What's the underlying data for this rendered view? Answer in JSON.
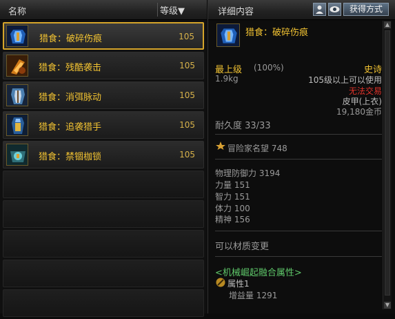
{
  "list": {
    "header_name": "名称",
    "header_level": "等级▼",
    "items": [
      {
        "label": "猎食：破碎伤痕",
        "level": "105"
      },
      {
        "label": "猎食：残酷袭击",
        "level": "105"
      },
      {
        "label": "猎食：消弭脉动",
        "level": "105"
      },
      {
        "label": "猎食：追袭猎手",
        "level": "105"
      },
      {
        "label": "猎食：禁锢枷锁",
        "level": "105"
      }
    ]
  },
  "detail": {
    "title": "详细内容",
    "obtain_button": "获得方式",
    "name": "猎食：破碎伤痕",
    "grade": "最上级",
    "grade_pct": "(100%)",
    "rarity": "史诗",
    "weight": "1.9kg",
    "level_req": "105级以上可以使用",
    "trade": "无法交易",
    "slot": "皮甲(上衣)",
    "price": "19,180金币",
    "durability": "耐久度 33/33",
    "fame": "冒险家名望  748",
    "phys_def": "物理防御力  3194",
    "stats": [
      "力量 151",
      "智力 151",
      "体力 100",
      "精神 156"
    ],
    "material_change": "可以材质变更",
    "fusion_title": "<机械崛起融合属性>",
    "attr_label": "属性1",
    "gain_label": "增益量  1291"
  },
  "colors": {
    "accent_gold": "#f1c232",
    "warn_red": "#e0322a",
    "fusion_green": "#5fc86a"
  }
}
